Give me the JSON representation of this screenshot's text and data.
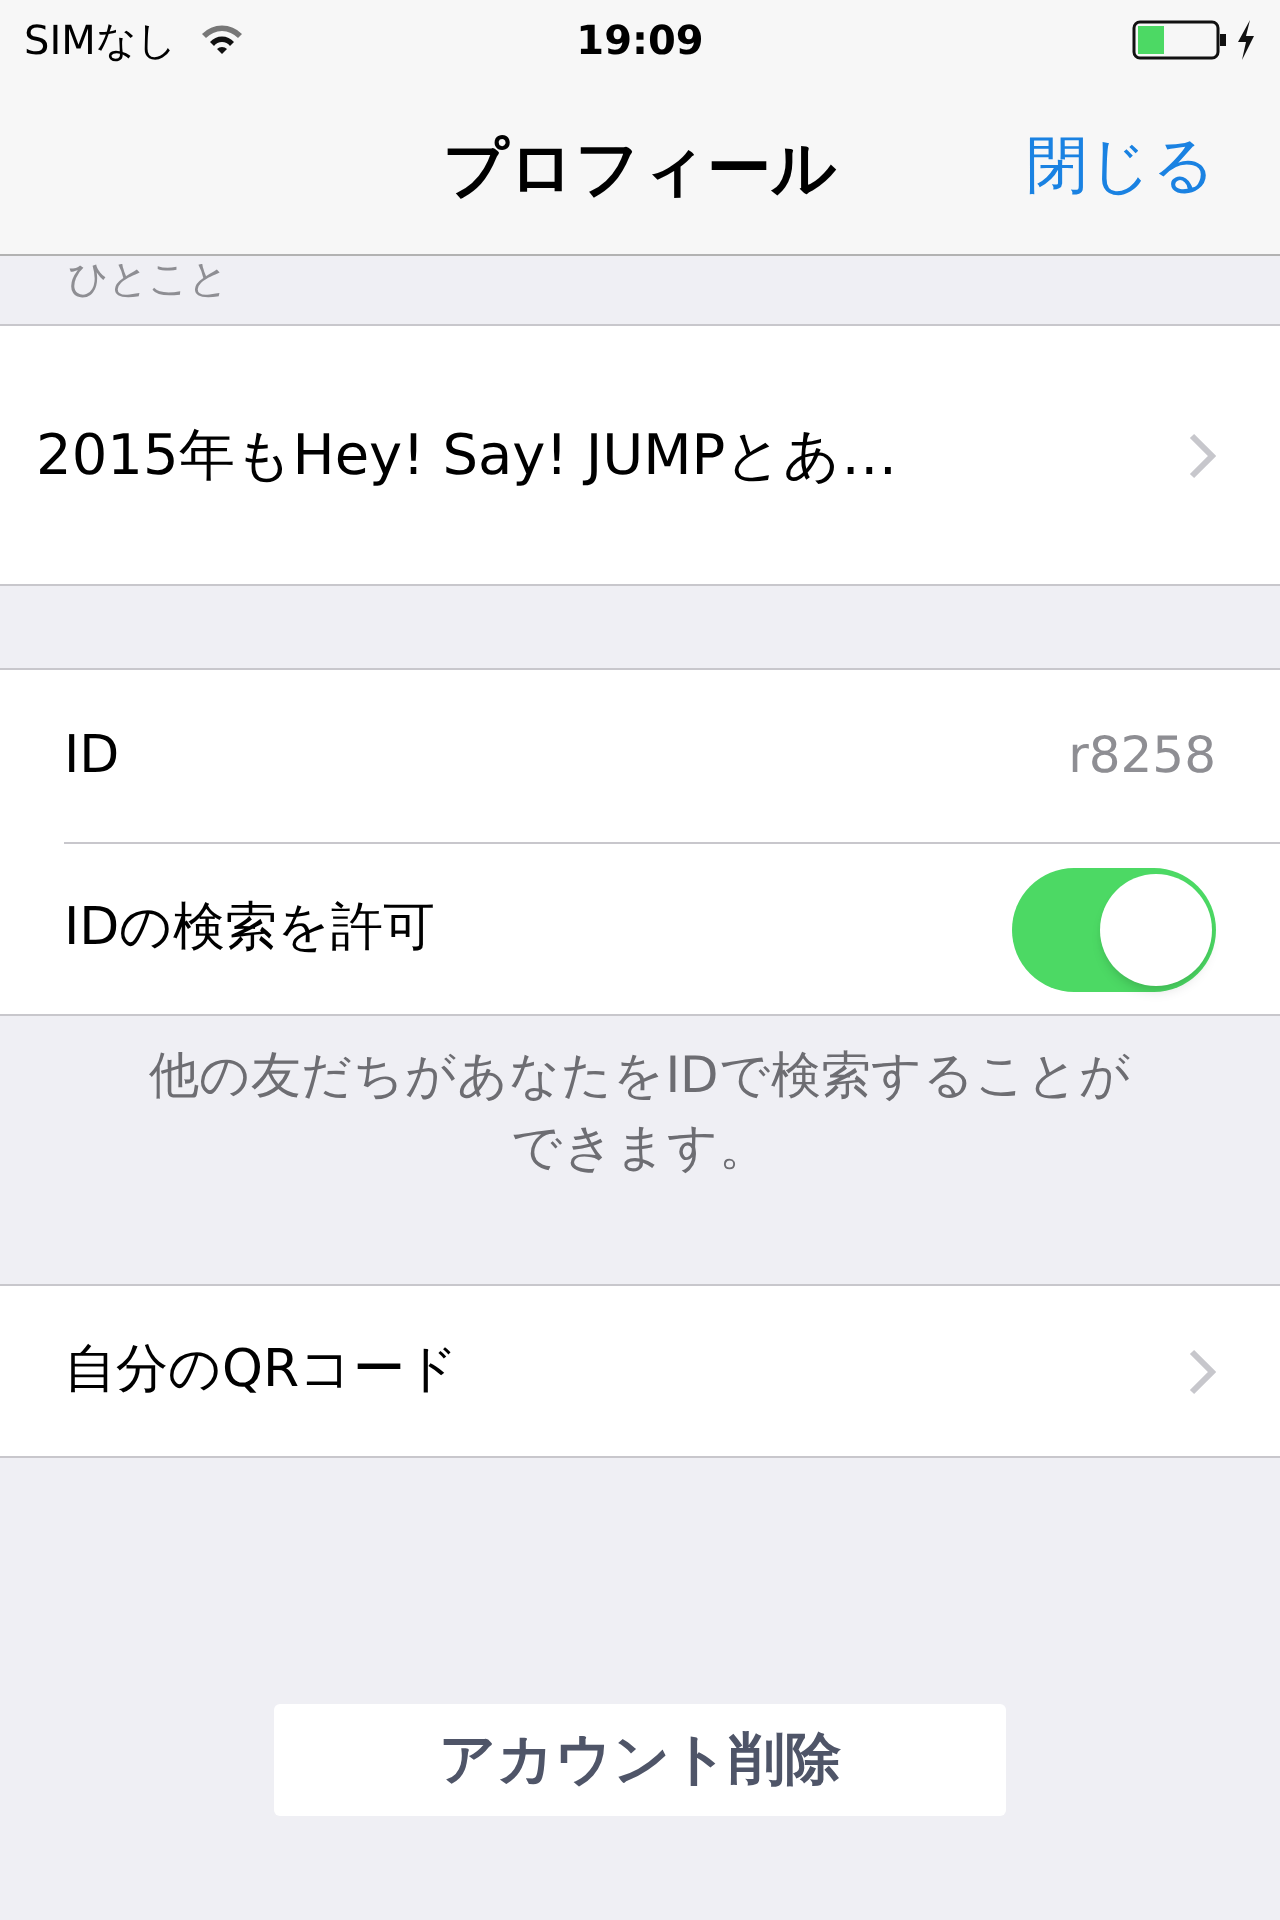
{
  "status_bar": {
    "carrier": "SIMなし",
    "time": "19:09",
    "charging": true
  },
  "nav_bar": {
    "title": "プロフィール",
    "close": "閉じる"
  },
  "status_message_section": {
    "header": "ひとこと",
    "value": "2015年もHey! Say! JUMPとあ…"
  },
  "id_section": {
    "rows": [
      {
        "kind": "value",
        "label": "ID",
        "value": "r8258"
      },
      {
        "kind": "toggle",
        "label": "IDの検索を許可",
        "on": true
      }
    ],
    "footer": "他の友だちがあなたをIDで検索することができます。"
  },
  "qr_row": {
    "label": "自分のQRコード"
  },
  "delete_button": "アカウント削除"
}
